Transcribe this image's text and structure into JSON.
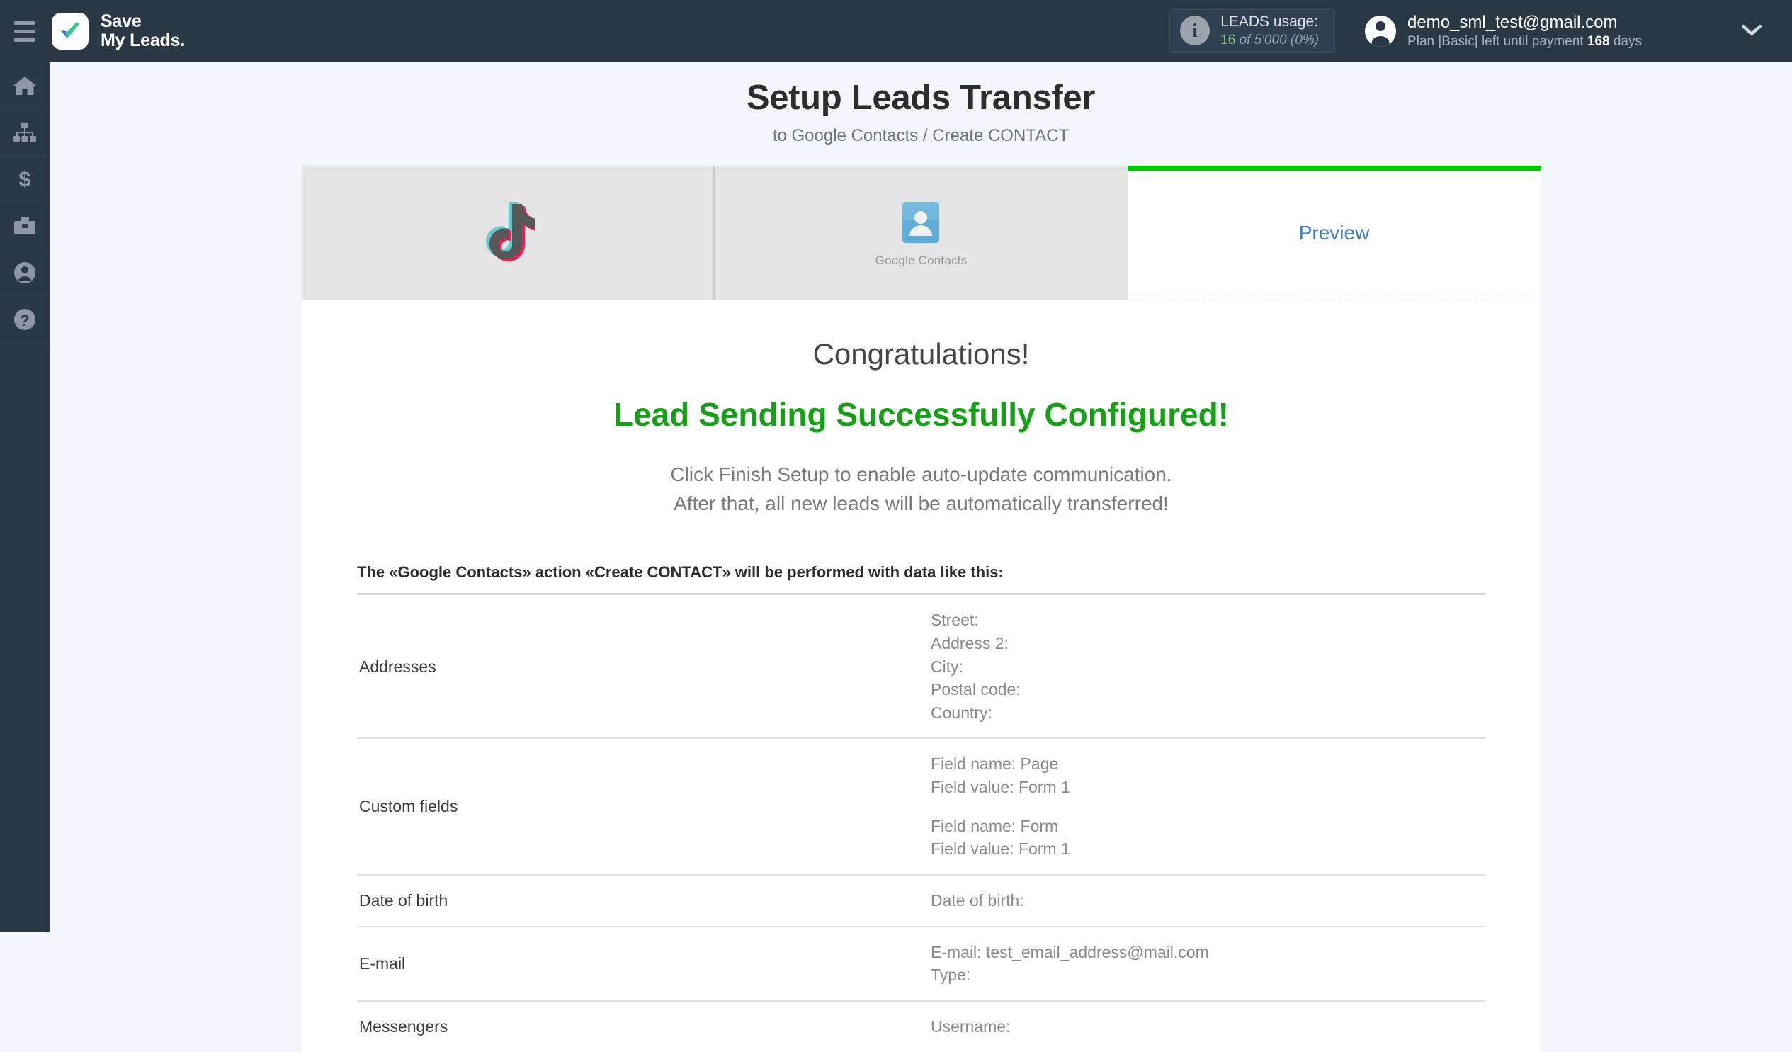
{
  "header": {
    "menu_icon": "hamburger-icon",
    "brand_line1": "Save",
    "brand_line2": "My Leads.",
    "usage": {
      "info_icon": "info-icon",
      "title": "LEADS usage:",
      "used": "16",
      "of": " of ",
      "total": "5'000",
      "percent": "(0%)"
    },
    "account": {
      "avatar_icon": "user-avatar-icon",
      "email": "demo_sml_test@gmail.com",
      "plan_prefix": "Plan |Basic| left until payment ",
      "plan_days": "168",
      "plan_suffix": " days",
      "chevron_icon": "chevron-down-icon"
    }
  },
  "sidebar": {
    "items": [
      {
        "name": "home",
        "icon": "home-icon"
      },
      {
        "name": "connections",
        "icon": "sitemap-icon"
      },
      {
        "name": "billing",
        "icon": "dollar-icon"
      },
      {
        "name": "services",
        "icon": "briefcase-icon"
      },
      {
        "name": "profile",
        "icon": "user-circle-icon"
      },
      {
        "name": "help",
        "icon": "question-circle-icon"
      }
    ]
  },
  "page": {
    "title": "Setup Leads Transfer",
    "subtitle": "to Google Contacts / Create CONTACT"
  },
  "tabs": {
    "source": {
      "label": "TikTok",
      "icon": "tiktok-logo"
    },
    "destination": {
      "label": "Google Contacts",
      "icon": "google-contacts-logo",
      "caption": "Google Contacts"
    },
    "preview": {
      "label": "Preview",
      "active": true,
      "accent_color": "#00c500"
    }
  },
  "content": {
    "congrats": "Congratulations!",
    "success": "Lead Sending Successfully Configured!",
    "instruction_line1": "Click Finish Setup to enable auto-update communication.",
    "instruction_line2": "After that, all new leads will be automatically transferred!",
    "table_caption": "The «Google Contacts» action «Create CONTACT» will be performed with data like this:",
    "rows": [
      {
        "key": "Addresses",
        "values": [
          "Street:",
          "Address 2:",
          "City:",
          "Postal code:",
          "Country:"
        ]
      },
      {
        "key": "Custom fields",
        "group1": [
          "Field name: Page",
          "Field value: Form 1"
        ],
        "group2": [
          "Field name: Form",
          "Field value: Form 1"
        ]
      },
      {
        "key": "Date of birth",
        "values": [
          "Date of birth:"
        ]
      },
      {
        "key": "E-mail",
        "values": [
          "E-mail: test_email_address@mail.com",
          "Type:"
        ]
      },
      {
        "key": "Messengers",
        "values": [
          "Username:"
        ]
      }
    ]
  },
  "colors": {
    "topbar": "#2b3947",
    "accent_green": "#00c500",
    "success_green": "#16a016",
    "link_blue": "#3d7ebd",
    "page_bg": "#f2f5fa"
  }
}
